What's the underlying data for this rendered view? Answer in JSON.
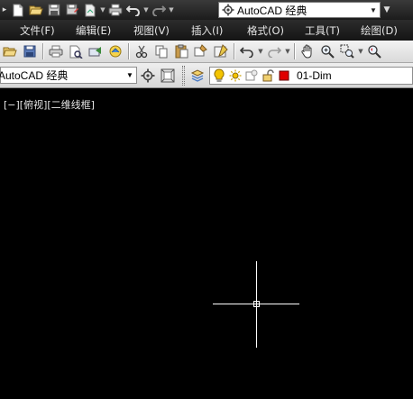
{
  "quick_access": {
    "workspace": "AutoCAD 经典"
  },
  "menu": {
    "items": [
      "文件(F)",
      "编辑(E)",
      "视图(V)",
      "插入(I)",
      "格式(O)",
      "工具(T)",
      "绘图(D)"
    ]
  },
  "workspace_toolbar": {
    "workspace": "AutoCAD 经典"
  },
  "layer": {
    "current": "01-Dim",
    "color": "#e00000"
  },
  "viewport": {
    "label": "[−][俯视][二维线框]"
  },
  "colors": {
    "canvas": "#000000",
    "ribbon_dark": "#1c1c1c",
    "toolbar_light": "#e2e2e2",
    "bulb": "#f4c400"
  }
}
